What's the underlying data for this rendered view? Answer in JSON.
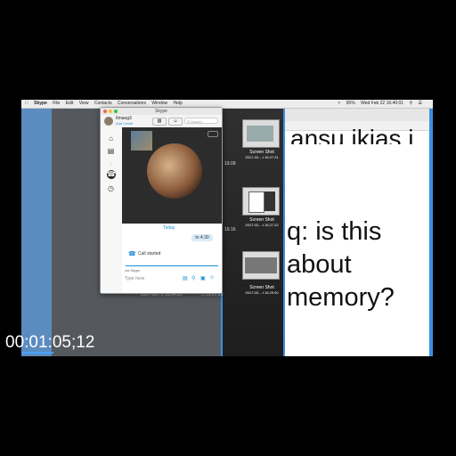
{
  "menubar": {
    "items": [
      "Skype",
      "File",
      "Edit",
      "View",
      "Contacts",
      "Conversations",
      "Window",
      "Help"
    ],
    "clock": "Wed Feb 22  16:40:01",
    "battery": "95%"
  },
  "skype": {
    "window_title": "Skype",
    "profile_name": "Ilmaeg3",
    "profile_sub": "Add Credit",
    "search_placeholder": "Search",
    "chat": {
      "date_label": "Today",
      "bubble_text": "to 4:30",
      "call_text": "Call started",
      "via_label": "via Skype",
      "input_placeholder": "Type here"
    }
  },
  "finder": {
    "items": [
      {
        "label_top": "Screen Shot",
        "label_bottom": "2017-02-...t 16.27.21",
        "left_time": "19.09"
      },
      {
        "label_top": "Screen Shot",
        "label_bottom": "2017-02-...t 16.27.22",
        "left_time": "19.16"
      },
      {
        "label_top": "Screen Shot",
        "label_bottom": "2017-02-...t 16.29.00",
        "left_time": "...t 16.21.20"
      }
    ],
    "bottom_left_time": "2017-02-...t 16.34.20"
  },
  "notes": {
    "line1": "ansu,ikjas,j",
    "line2": "q: is this",
    "line3": "about",
    "line4": "memory?"
  },
  "video": {
    "timecode": "00:01:05;12"
  }
}
